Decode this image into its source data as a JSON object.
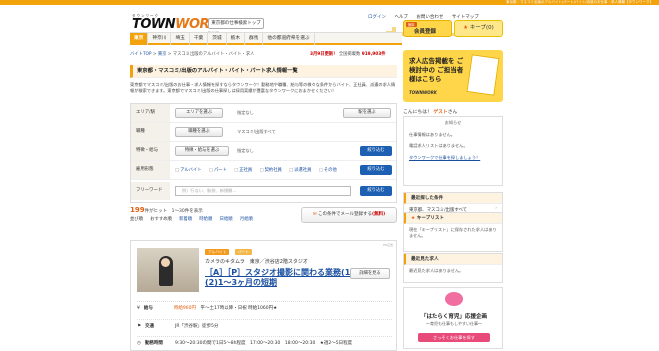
{
  "topbar": {
    "text": "東京都・マスコミ出版のアルバイト/パート/バイト/派遣のお仕事・求人情報【タウンワーク】"
  },
  "header": {
    "logo_small": "タウンワーク",
    "logo_main": "TOWN",
    "logo_accent": "WORK",
    "logo_sub": "Recruit",
    "pref_button": "東京都の仕事検索トップ",
    "links": [
      "ログイン",
      "ヘルプ",
      "お問い合わせ",
      "サイトマップ"
    ],
    "register_button": "会員登録",
    "register_badge": "無料",
    "keep_button": "キープ",
    "keep_count": "(0)"
  },
  "nav": {
    "tabs": [
      "東京",
      "神奈川",
      "埼玉",
      "千葉",
      "茨城",
      "栃木",
      "群馬",
      "他の都道府県を選ぶ"
    ]
  },
  "breadcrumb": {
    "items": [
      "バイトTOP",
      "東京",
      "マスコミ出版のアルバイト・バイト・求人"
    ]
  },
  "update": {
    "date": "3月9日更新！",
    "label": "全国掲載数",
    "count": "919,903件"
  },
  "page_title": "東京都・マスコミ/出版のアルバイト・バイト・パート求人情報一覧",
  "intro": "東京都でマスコミ/出版のお仕事・求人情報を探すならタウンワーク！勤務地や職種、給与等の様々な条件からバイト、正社員、派遣の求人情報が検索できます。東京都でマスコミ/出版の仕事探しは採用実績が豊富なタウンワークにおまかせください！",
  "search": {
    "area_label": "エリア/駅",
    "area_button": "エリアを選ぶ",
    "area_value": "指定なし",
    "station_button": "駅を選ぶ",
    "job_label": "職種",
    "job_button": "職種を選ぶ",
    "job_value": "マスコミ/出版すべて",
    "feature_label": "特徴・給与",
    "feature_button": "特徴・給与を選ぶ",
    "feature_value": "指定なし",
    "emp_label": "雇用形態",
    "emp_types": [
      "アルバイト",
      "パート",
      "正社員",
      "契約社員",
      "派遣社員",
      "その他"
    ],
    "narrow_button": "絞り込む",
    "free_label": "フリーワード",
    "free_placeholder": "例）行ない、駅前、新規開..."
  },
  "results": {
    "count": "199",
    "count_unit": "件がヒット",
    "range": "1〜30件を表示",
    "sort_label": "並び順",
    "sorts": [
      "おすすめ順",
      "新着順",
      "時給順",
      "日給順",
      "月給順"
    ],
    "mail_button": "この条件でメール登録する",
    "mail_badge": "(無料)"
  },
  "job": {
    "ad_label": "PR広告",
    "tags": [
      "アルバイト",
      "パート"
    ],
    "company": "カメラのキタムラ　東京／渋谷店2階スタジオ",
    "title": "［A］［P］スタジオ撮影に関わる業務(1)長期(2)1～3ヶ月の短期",
    "detail_button": "詳細を見る",
    "rows": [
      {
        "key": "給与",
        "pay": "時給960円",
        "rest": "平～土17時以降・日祝 時給1060円★"
      },
      {
        "key": "交通",
        "pay": "",
        "rest": "JR「渋谷駅」徒歩5分"
      },
      {
        "key": "勤務時間",
        "pay": "",
        "rest": "9:30～20:30の間で1日5～8h程度　17:00～20:30　18:00～20:30　★週2～5日程度"
      }
    ]
  },
  "sidebar": {
    "ad_title": "求人広告掲載を ご検討中の ご担当者様はこちら",
    "ad_sub": "TOWNWORK",
    "welcome": "こんにちは！",
    "guest": "ゲスト",
    "guest_suffix": "さん",
    "notice_head": "お知らせ",
    "notice_lines": [
      "仕事情報はありません。",
      "電話求人リストはありません。",
      "タウンワークで仕事を探しましょう！"
    ],
    "recent_head": "最近探した条件",
    "recent_item": "東京都、マスコミ/出版すべて",
    "recent_button": "この条件でお仕事を探す",
    "keep_head": "キープリスト",
    "keep_text": "現在「キープリスト」に保存された求人はありません。",
    "recent_jobs_head": "最近見た求人",
    "recent_jobs_text": "最近見た求人はありません。",
    "banner_title": "「はたらく育児」応援企画",
    "banner_sub": "～育児も仕事もしやすい仕事～",
    "banner_link": "さっそくお仕事を探す"
  },
  "colors": {
    "accent": "#f2a20a",
    "link": "#1a4fa0",
    "pay": "#e06010",
    "button_blue": "#1d5fb2"
  }
}
